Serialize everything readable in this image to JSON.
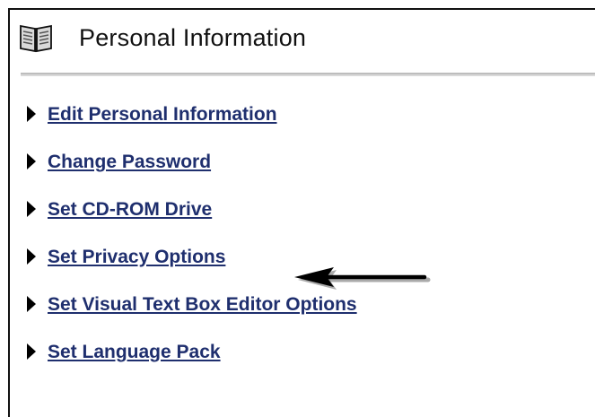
{
  "header": {
    "title": "Personal Information",
    "icon": "book-icon"
  },
  "links": [
    {
      "label": "Edit Personal Information"
    },
    {
      "label": "Change Password"
    },
    {
      "label": "Set CD-ROM Drive"
    },
    {
      "label": "Set Privacy Options"
    },
    {
      "label": "Set Visual Text Box Editor Options"
    },
    {
      "label": "Set Language Pack"
    }
  ],
  "annotation": {
    "icon": "arrow-left-icon",
    "target": "Set Privacy Options"
  },
  "colors": {
    "link": "#1f2f6e",
    "text": "#111111",
    "divider": "#bdbdbd"
  }
}
